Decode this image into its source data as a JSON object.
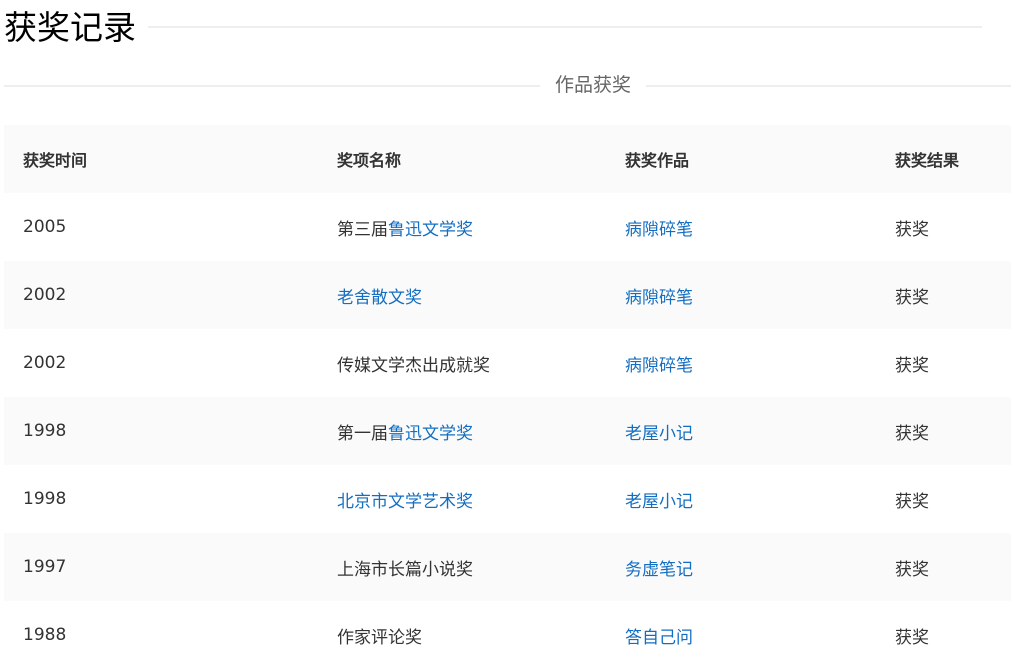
{
  "title": "获奖记录",
  "section": "作品获奖",
  "colors": {
    "link": "#136ec2"
  },
  "headers": [
    "获奖时间",
    "奖项名称",
    "获奖作品",
    "获奖结果"
  ],
  "rows": [
    {
      "year": "2005",
      "prefix": "第三届",
      "award": "鲁迅文学奖",
      "award_link": true,
      "work": "病隙碎笔",
      "result": "获奖"
    },
    {
      "year": "2002",
      "prefix": "",
      "award": "老舍散文奖",
      "award_link": true,
      "work": "病隙碎笔",
      "result": "获奖"
    },
    {
      "year": "2002",
      "prefix": "传媒文学杰出成就奖",
      "award": "",
      "award_link": false,
      "work": "病隙碎笔",
      "result": "获奖"
    },
    {
      "year": "1998",
      "prefix": "第一届",
      "award": "鲁迅文学奖",
      "award_link": true,
      "work": "老屋小记",
      "result": "获奖"
    },
    {
      "year": "1998",
      "prefix": "",
      "award": "北京市文学艺术奖",
      "award_link": true,
      "work": "老屋小记",
      "result": "获奖"
    },
    {
      "year": "1997",
      "prefix": "上海市长篇小说奖",
      "award": "",
      "award_link": false,
      "work": "务虚笔记",
      "result": "获奖"
    },
    {
      "year": "1988",
      "prefix": "作家评论奖",
      "award": "",
      "award_link": false,
      "work": "答自己问",
      "result": "获奖"
    }
  ]
}
